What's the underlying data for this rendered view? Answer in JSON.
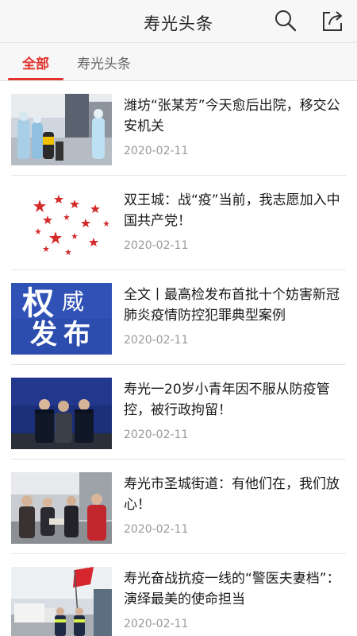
{
  "header": {
    "title": "寿光头条",
    "search_icon": "search-icon",
    "share_icon": "share-icon"
  },
  "tabs": [
    {
      "label": "全部",
      "active": true
    },
    {
      "label": "寿光头条",
      "active": false
    }
  ],
  "colors": {
    "accent": "#e2332e",
    "text": "#1a1a1a",
    "date": "#999999",
    "bar": "#f7f7f7"
  },
  "articles": [
    {
      "title": "潍坊“张某芳”今天愈后出院，移交公安机关",
      "date": "2020-02-11"
    },
    {
      "title": "双王城：战“疫”当前，我志愿加入中国共产党！",
      "date": "2020-02-11"
    },
    {
      "title": "全文丨最高检发布首批十个妨害新冠肺炎疫情防控犯罪典型案例",
      "date": "2020-02-11",
      "thumb_text": [
        "权",
        "威",
        "发",
        "布"
      ]
    },
    {
      "title": "寿光一20岁小青年因不服从防疫管控，被行政拘留！",
      "date": "2020-02-11"
    },
    {
      "title": "寿光市圣城街道：有他们在，我们放心！",
      "date": "2020-02-11"
    },
    {
      "title": "寿光奋战抗疫一线的“警医夫妻档”：演绎最美的使命担当",
      "date": "2020-02-11"
    }
  ]
}
